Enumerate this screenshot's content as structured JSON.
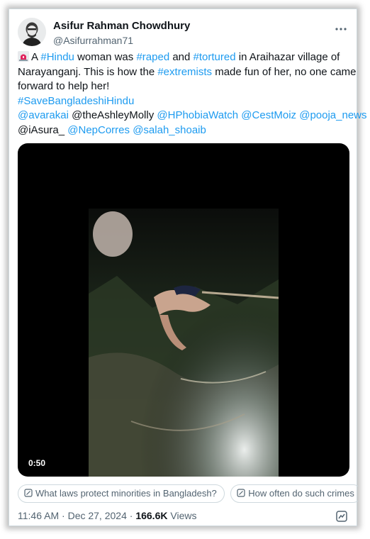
{
  "author": {
    "name": "Asifur Rahman Chowdhury",
    "handle": "@Asifurrahman71"
  },
  "tweet": {
    "alert_icon": "rotating-light-icon",
    "lines": [
      [
        {
          "t": "A ",
          "tag": false
        },
        {
          "t": "#Hindu",
          "tag": true
        },
        {
          "t": " woman was ",
          "tag": false
        },
        {
          "t": "#raped",
          "tag": true
        },
        {
          "t": " and ",
          "tag": false
        },
        {
          "t": "#tortured",
          "tag": true
        },
        {
          "t": " in Araihazar village of",
          "tag": false
        }
      ],
      [
        {
          "t": "Narayanganj. This is how the ",
          "tag": false
        },
        {
          "t": "#extremists",
          "tag": true
        },
        {
          "t": " made fun of her, no one came",
          "tag": false
        }
      ],
      [
        {
          "t": "forward to help her!",
          "tag": false
        }
      ],
      [
        {
          "t": "#SaveBangladeshiHindu",
          "tag": true
        }
      ],
      [
        {
          "t": "@avarakai",
          "tag": true
        },
        {
          "t": " @theAshleyMolly ",
          "tag": false
        },
        {
          "t": "@HPhobiaWatch",
          "tag": true
        },
        {
          "t": " ",
          "tag": false
        },
        {
          "t": "@CestMoiz",
          "tag": true
        },
        {
          "t": " ",
          "tag": false
        },
        {
          "t": "@pooja_news",
          "tag": true
        }
      ],
      [
        {
          "t": "@iAsura_ ",
          "tag": false
        },
        {
          "t": "@NepCorres",
          "tag": true
        },
        {
          "t": " ",
          "tag": false
        },
        {
          "t": "@salah_shoaib",
          "tag": true
        }
      ]
    ]
  },
  "media": {
    "duration": "0:50"
  },
  "suggestions": [
    "What laws protect minorities in Bangladesh?",
    "How often do such crimes"
  ],
  "meta": {
    "time": "11:46 AM",
    "separator": " · ",
    "date": "Dec 27, 2024",
    "views_count": "166.6K",
    "views_label": " Views"
  },
  "colors": {
    "link": "#1d9bf0",
    "text": "#0f1419",
    "secondary": "#536471",
    "border": "#cfd9de"
  }
}
